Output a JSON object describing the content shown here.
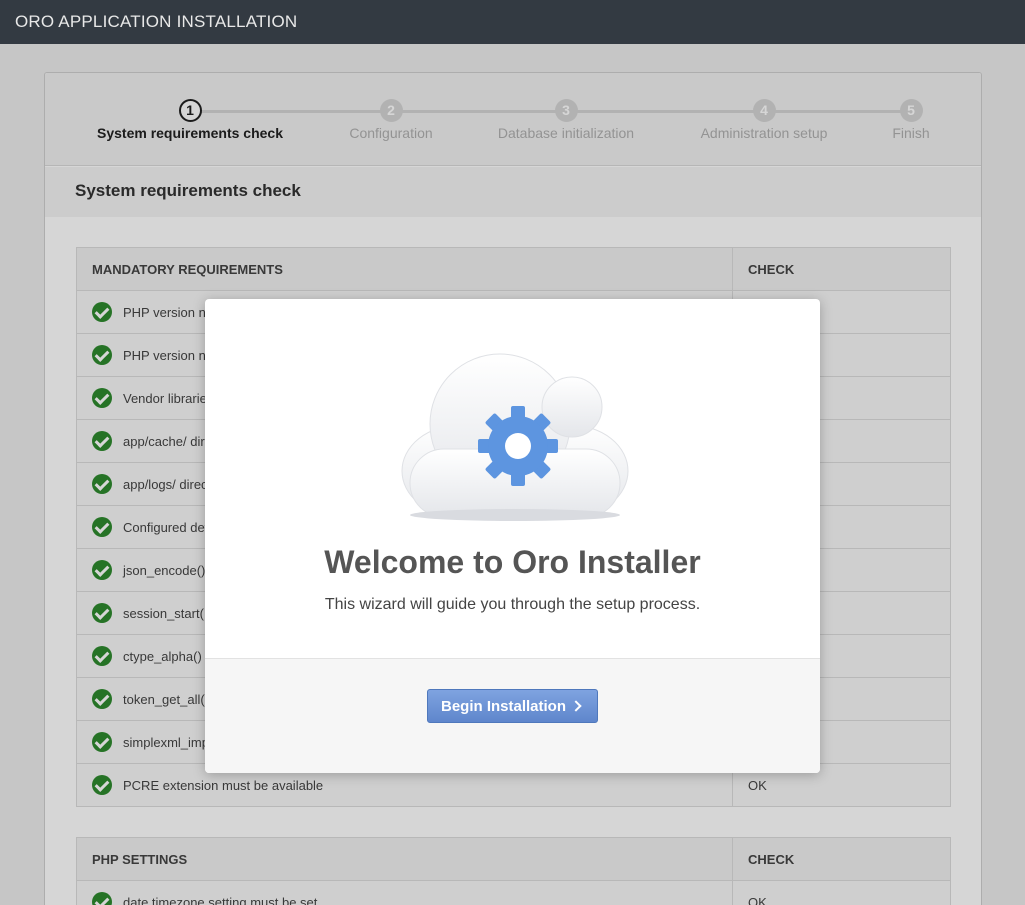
{
  "app_title": "ORO APPLICATION INSTALLATION",
  "steps": [
    {
      "num": "1",
      "label": "System requirements check"
    },
    {
      "num": "2",
      "label": "Configuration"
    },
    {
      "num": "3",
      "label": "Database initialization"
    },
    {
      "num": "4",
      "label": "Administration setup"
    },
    {
      "num": "5",
      "label": "Finish"
    }
  ],
  "section_title": "System requirements check",
  "mandatory": {
    "header": "MANDATORY REQUIREMENTS",
    "check_header": "CHECK",
    "rows": [
      {
        "label": "PHP version n",
        "status": ""
      },
      {
        "label": "PHP version n",
        "status": ""
      },
      {
        "label": "Vendor librarie",
        "status": ""
      },
      {
        "label": "app/cache/ dir",
        "status": ""
      },
      {
        "label": "app/logs/ direc",
        "status": ""
      },
      {
        "label": "Configured def",
        "status": ""
      },
      {
        "label": "json_encode()",
        "status": ""
      },
      {
        "label": "session_start(",
        "status": ""
      },
      {
        "label": "ctype_alpha()",
        "status": ""
      },
      {
        "label": "token_get_all()",
        "status": ""
      },
      {
        "label": "simplexml_imp",
        "status": ""
      },
      {
        "label": "PCRE extension must be available",
        "status": "OK"
      }
    ]
  },
  "php_settings": {
    "header": "PHP SETTINGS",
    "check_header": "CHECK",
    "rows": [
      {
        "label": "date.timezone setting must be set",
        "status": "OK"
      }
    ]
  },
  "modal": {
    "title": "Welcome to Oro Installer",
    "subtitle": "This wizard will guide you through the setup process.",
    "button_label": "Begin Installation",
    "art_icon": "cloud-gear-icon"
  },
  "colors": {
    "topbar": "#333a42",
    "button": "#6a8fd3",
    "check_ok": "#2e8a2e",
    "gear": "#5d95e0"
  }
}
